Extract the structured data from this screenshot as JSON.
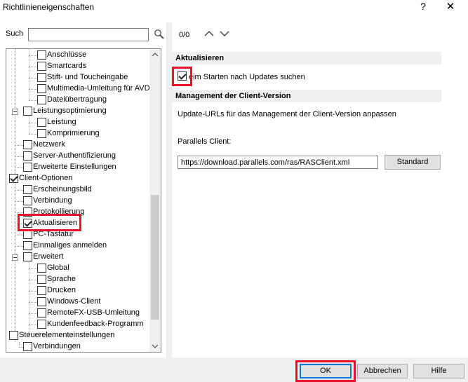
{
  "window": {
    "title": "Richtlinieneigenschaften",
    "help_glyph": "?",
    "close_glyph": "✕"
  },
  "search": {
    "label": "Such",
    "value": "",
    "counter": "0/0"
  },
  "tree": {
    "items": [
      {
        "label": "Anschlüsse",
        "checked": false
      },
      {
        "label": "Smartcards",
        "checked": false
      },
      {
        "label": "Stift- und Toucheingabe",
        "checked": false
      },
      {
        "label": "Multimedia-Umleitung für AVD",
        "checked": false
      },
      {
        "label": "Dateiübertragung",
        "checked": false
      },
      {
        "label": "Leistungsoptimierung",
        "checked": false
      },
      {
        "label": "Leistung",
        "checked": false
      },
      {
        "label": "Komprimierung",
        "checked": false
      },
      {
        "label": "Netzwerk",
        "checked": false
      },
      {
        "label": "Server-Authentifizierung",
        "checked": false
      },
      {
        "label": "Erweiterte Einstellungen",
        "checked": false
      },
      {
        "label": "Client-Optionen",
        "checked": true
      },
      {
        "label": "Erscheinungsbild",
        "checked": false
      },
      {
        "label": "Verbindung",
        "checked": false
      },
      {
        "label": "Protokollierung",
        "checked": false
      },
      {
        "label": "Aktualisieren",
        "checked": true
      },
      {
        "label": "PC-Tastatur",
        "checked": false
      },
      {
        "label": "Einmaliges anmelden",
        "checked": false
      },
      {
        "label": "Erweitert",
        "checked": false
      },
      {
        "label": "Global",
        "checked": false
      },
      {
        "label": "Sprache",
        "checked": false
      },
      {
        "label": "Drucken",
        "checked": false
      },
      {
        "label": "Windows-Client",
        "checked": false
      },
      {
        "label": "RemoteFX-USB-Umleitung",
        "checked": false
      },
      {
        "label": "Kundenfeedback-Programm",
        "checked": false
      },
      {
        "label": "Steuerelementeinstellungen",
        "checked": false
      },
      {
        "label": "Verbindungen",
        "checked": false
      }
    ]
  },
  "panel": {
    "section_update": "Aktualisieren",
    "update_checkbox_label": "eim Starten nach Updates suchen",
    "update_checked": true,
    "section_client_version": "Management der Client-Version",
    "description": "Update-URLs für das Management der Client-Version anpassen",
    "client_label": "Parallels Client:",
    "client_url": "https://download.parallels.com/ras/RASClient.xml",
    "standard_button": "Standard"
  },
  "footer": {
    "ok": "OK",
    "cancel": "Abbrechen",
    "help": "Hilfe"
  },
  "colors": {
    "highlight": "#e8102a",
    "section_bg": "#f0f0f0",
    "default_button_border": "#0078d7"
  }
}
